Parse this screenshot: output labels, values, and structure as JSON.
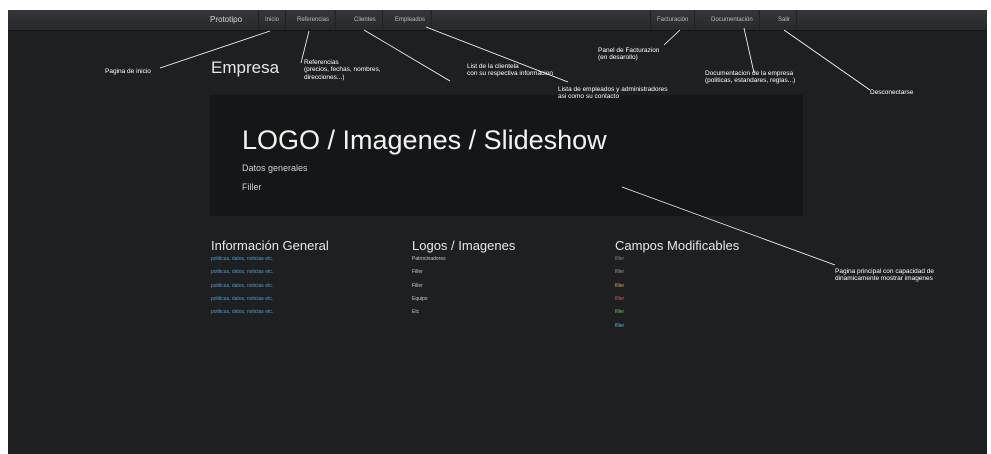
{
  "nav": {
    "brand": "Prototipo",
    "inicio": "Inicio",
    "referencias": "Referencias",
    "clientes": "Clientes",
    "empleados": "Empleados",
    "facturacion": "Facturación",
    "documentacion": "Documentación",
    "salir": "Salir"
  },
  "page": {
    "heading": "Empresa",
    "hero_title": "LOGO / Imagenes / Slideshow",
    "hero_line1": "Datos generales",
    "hero_line2": "Filler"
  },
  "columns": {
    "info": {
      "title": "Información General",
      "links": [
        "politicas, datos, noticias etc.",
        "politicas, datos, noticias etc.",
        "politicas, datos, noticias etc.",
        "politicas, datos, noticias etc.",
        "politicas, datos, noticias etc."
      ]
    },
    "logos": {
      "title": "Logos / Imagenes",
      "items": [
        "Patrocinadores",
        "Filler",
        "Filler",
        "Equipo",
        "Etc"
      ]
    },
    "campos": {
      "title": "Campos Modificables",
      "items": [
        "filler",
        "filler",
        "filler",
        "filler",
        "filler",
        "filler"
      ]
    }
  },
  "colors": {
    "link_blue": "#4a9fd0",
    "campos": [
      "#7b8890",
      "#8f9aa2",
      "#e8a13a",
      "#d9534f",
      "#6cc04a",
      "#4ab3e0"
    ]
  },
  "annotations": {
    "inicio": "Pagina de inicio",
    "referencias": "Referencias\n(precios, fechas, nombres,\ndirecciones...)",
    "clientes": "List de la clientela\ncon su respectiva informacion",
    "empleados": "Lista de empleados y administradores\nasi como su contacto",
    "facturacion": "Panel de Facturazion\n(en desarollo)",
    "documentacion": "Documentacion de la empresa\n(politicas, estandares, reglas...)",
    "salir": "Desconectarse",
    "principal": "Pagina principal con capacidad de\ndinamicamente mostrar imagenes"
  }
}
